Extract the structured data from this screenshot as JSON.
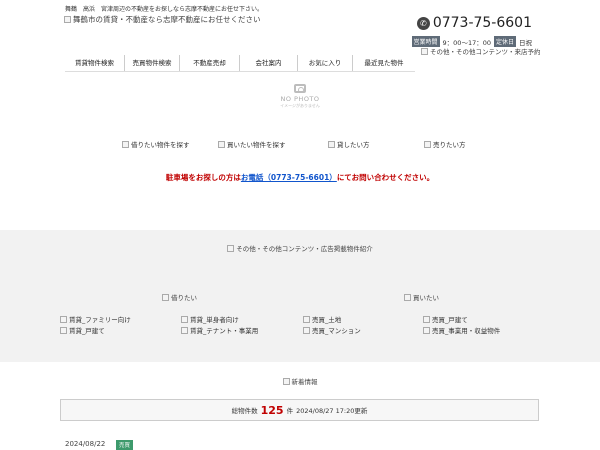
{
  "header": {
    "tagline": "舞鶴　高浜　宮津周辺の不動産をお探しなら志摩不動産にお任せ下さい。",
    "logo_alt": "舞鶴市の賃貸・不動産なら志摩不動産にお任せください",
    "phone": "0773-75-6601",
    "hours_label": "営業時間",
    "hours": "9：00～17：00",
    "holiday_label": "定休日",
    "holiday": "日祝",
    "other_link": "その他・その他コンテンツ・来店予約"
  },
  "nav": {
    "items": [
      {
        "label": "賃貸物件検索"
      },
      {
        "label": "売買物件検索"
      },
      {
        "label": "不動産売却"
      },
      {
        "label": "会社案内"
      },
      {
        "label": "お気に入り"
      },
      {
        "label": "最近見た物件"
      }
    ]
  },
  "placeholder": {
    "title": "NO PHOTO",
    "subtitle": "イメージがありません"
  },
  "quick_links": [
    {
      "label": "借りたい物件を探す"
    },
    {
      "label": "買いたい物件を探す"
    },
    {
      "label": "貸したい方"
    },
    {
      "label": "売りたい方"
    }
  ],
  "notice": {
    "before": "駐車場をお探しの方は",
    "tel": "お電話（0773-75-6601）",
    "after": "にてお問い合わせください。"
  },
  "featured": {
    "title": "その他・その他コンテンツ・広告掲載物件紹介",
    "rent_heading": "借りたい",
    "buy_heading": "買いたい",
    "rent_links": [
      "賃貸_ファミリー向け",
      "賃貸_戸建て",
      "賃貸_単身者向け",
      "賃貸_テナント・事業用"
    ],
    "buy_links": [
      "売買_土地",
      "売買_マンション",
      "売買_戸建て",
      "売買_事業用・収益物件"
    ]
  },
  "news": {
    "heading": "新着情報",
    "count_label": "総物件数",
    "count": "125",
    "count_unit": "件",
    "updated": "2024/08/27 17:20更新",
    "first_date": "2024/08/22",
    "first_tag": "売買"
  }
}
